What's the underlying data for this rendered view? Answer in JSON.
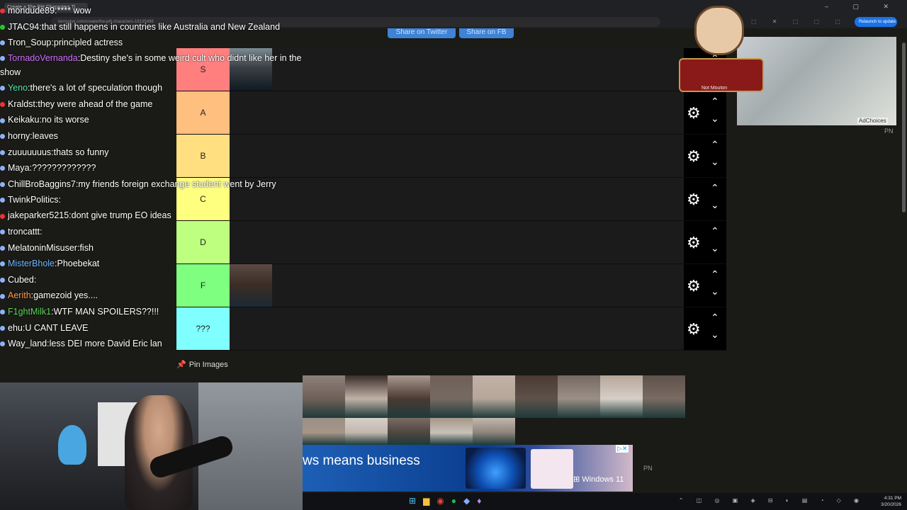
{
  "browser": {
    "tab_title": "Create a The Pitt Characters Ti...",
    "url": "tiermaker.com/create/the-pitt-characters-18135498",
    "relaunch_label": "Relaunch to update",
    "window_controls": "–  ▢  ✕"
  },
  "share": {
    "twitter_label": "Share on Twitter",
    "fb_label": "Share on FB"
  },
  "tiers": [
    {
      "label": "S",
      "color": "#ff7f7f",
      "images": 1
    },
    {
      "label": "A",
      "color": "#ffbf7f",
      "images": 0
    },
    {
      "label": "B",
      "color": "#ffdf7f",
      "images": 0
    },
    {
      "label": "C",
      "color": "#ffff7f",
      "images": 0
    },
    {
      "label": "D",
      "color": "#bfff7f",
      "images": 0
    },
    {
      "label": "F",
      "color": "#7fff7f",
      "images": 1
    },
    {
      "label": "???",
      "color": "#7fffff",
      "images": 0
    }
  ],
  "pin_images_label": "Pin Images",
  "ad": {
    "headline": "ws means business",
    "brand": "Windows 11",
    "adchoices": "AdChoices",
    "pn": "PN"
  },
  "overlay": {
    "name_tag": "Not Mouton"
  },
  "chat": [
    {
      "user": "mondude89",
      "color": "#ffffff",
      "badge": "red",
      "message": "**** wow"
    },
    {
      "user": "JTAC94",
      "color": "#ffffff",
      "badge": "green",
      "message": "that still happens in countries like Australia and New Zealand"
    },
    {
      "user": "Tron_Soup",
      "color": "#ffffff",
      "badge": "blue",
      "message": "principled actress"
    },
    {
      "user": "TornadoVernanda",
      "color": "#d070ff",
      "badge": "blue",
      "message": "Destiny she's in some weird cult who didnt like her in the show"
    },
    {
      "user": "Yeno",
      "color": "#4fe6a6",
      "badge": "blue",
      "message": "there's a lot of speculation though"
    },
    {
      "user": "Kraldst",
      "color": "#ffffff",
      "badge": "red",
      "message": "they were ahead of the game"
    },
    {
      "user": "Keikaku",
      "color": "#ffffff",
      "badge": "blue",
      "message": "no its worse"
    },
    {
      "user": "horny",
      "color": "#ffffff",
      "badge": "blue",
      "message": "leaves"
    },
    {
      "user": "zuuuuuuus",
      "color": "#ffffff",
      "badge": "blue",
      "message": "thats so funny"
    },
    {
      "user": "Maya",
      "color": "#ffffff",
      "badge": "blue",
      "message": "?????????????"
    },
    {
      "user": "ChillBroBaggins7",
      "color": "#ffffff",
      "badge": "blue",
      "message": "my friends foreign exchange student went by Jerry"
    },
    {
      "user": "TwinkPolitics",
      "color": "#ffffff",
      "badge": "blue",
      "message": ""
    },
    {
      "user": "jakeparker5215",
      "color": "#ffffff",
      "badge": "red",
      "message": "dont give trump EO ideas"
    },
    {
      "user": "troncattt",
      "color": "#ffffff",
      "badge": "blue",
      "message": ""
    },
    {
      "user": "MelatoninMisuser",
      "color": "#ffffff",
      "badge": "blue",
      "message": "fish"
    },
    {
      "user": "MisterBhole",
      "color": "#6fb7ff",
      "badge": "blue",
      "message": "Phoebekat"
    },
    {
      "user": "Cubed",
      "color": "#ffffff",
      "badge": "blue",
      "message": ""
    },
    {
      "user": "Aerith",
      "color": "#ff9a4c",
      "badge": "blue",
      "message": "gamezoid yes...."
    },
    {
      "user": "F1ghtMilk1",
      "color": "#5cd65c",
      "badge": "blue",
      "message": "WTF MAN SPOILERS??!!!"
    },
    {
      "user": "ehu",
      "color": "#ffffff",
      "badge": "blue",
      "message": "U CANT LEAVE"
    },
    {
      "user": "Way_land",
      "color": "#ffffff",
      "badge": "blue",
      "message": "less DEI more David Eric lan"
    }
  ],
  "taskbar": {
    "time": "4:31 PM",
    "date": "3/20/2026"
  }
}
